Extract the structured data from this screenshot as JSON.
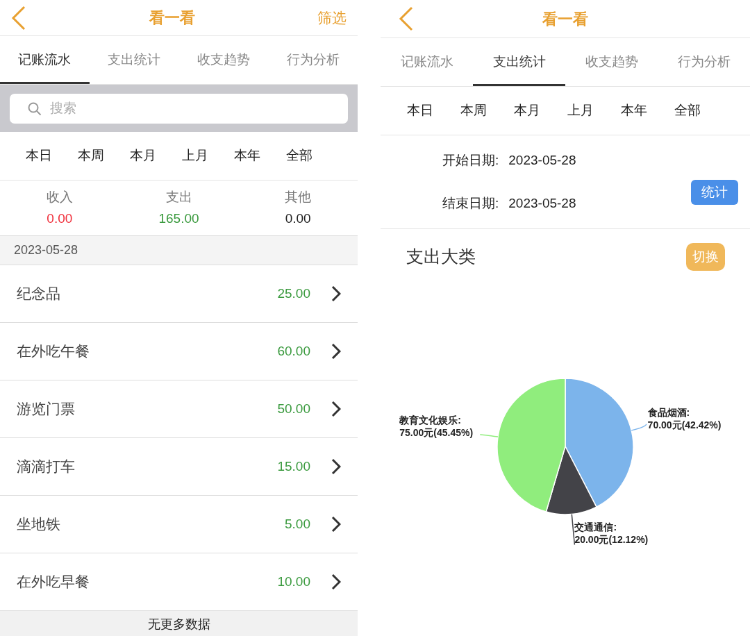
{
  "left": {
    "header": {
      "title": "看一看",
      "action": "筛选"
    },
    "tabs": [
      {
        "label": "记账流水",
        "selected": true
      },
      {
        "label": "支出统计",
        "selected": false
      },
      {
        "label": "收支趋势",
        "selected": false
      },
      {
        "label": "行为分析",
        "selected": false
      }
    ],
    "search": {
      "placeholder": "搜索"
    },
    "periods": [
      "本日",
      "本周",
      "本月",
      "上月",
      "本年",
      "全部"
    ],
    "summary": [
      {
        "label": "收入",
        "value": "0.00",
        "color": "#f0303c"
      },
      {
        "label": "支出",
        "value": "165.00",
        "color": "#3a9a3e"
      },
      {
        "label": "其他",
        "value": "0.00",
        "color": "#222222"
      }
    ],
    "date_header": "2023-05-28",
    "records": [
      {
        "name": "纪念品",
        "amount": "25.00"
      },
      {
        "name": "在外吃午餐",
        "amount": "60.00"
      },
      {
        "name": "游览门票",
        "amount": "50.00"
      },
      {
        "name": "滴滴打车",
        "amount": "15.00"
      },
      {
        "name": "坐地铁",
        "amount": "5.00"
      },
      {
        "name": "在外吃早餐",
        "amount": "10.00"
      }
    ],
    "footer": "无更多数据"
  },
  "right": {
    "header": {
      "title": "看一看"
    },
    "tabs": [
      {
        "label": "记账流水",
        "selected": false
      },
      {
        "label": "支出统计",
        "selected": true
      },
      {
        "label": "收支趋势",
        "selected": false
      },
      {
        "label": "行为分析",
        "selected": false
      }
    ],
    "periods": [
      "本日",
      "本周",
      "本月",
      "上月",
      "本年",
      "全部"
    ],
    "start_date": {
      "label": "开始日期:",
      "value": "2023-05-28"
    },
    "end_date": {
      "label": "结束日期:",
      "value": "2023-05-28"
    },
    "stat_button": "统计",
    "section": {
      "title": "支出大类",
      "switch_button": "切换"
    },
    "slice_label_separator": ":",
    "chart_data": {
      "type": "pie",
      "categories": [
        "食品烟酒",
        "交通通信",
        "教育文化娱乐"
      ],
      "series": [
        {
          "values": [
            42.42,
            12.12,
            45.45
          ]
        }
      ],
      "colors": [
        "#7cb4eb",
        "#434348",
        "#90ed7d"
      ],
      "value_labels": [
        "70.00元(42.42%)",
        "20.00元(12.12%)",
        "75.00元(45.45%)"
      ]
    }
  }
}
